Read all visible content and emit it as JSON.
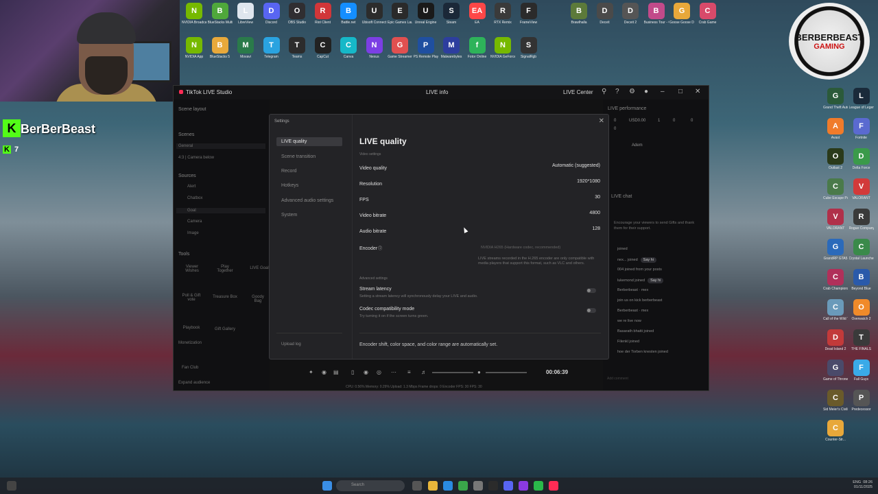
{
  "webcam": {
    "channel_name": "BerBerBeast",
    "kick_logo": "K",
    "kick_count_icon": "K",
    "viewer_count": "7"
  },
  "badge": {
    "line1": "BERBERBEAST",
    "line2": "GAMING"
  },
  "desktop_top_row1": [
    {
      "label": "NVIDIA Broadcast",
      "color": "#76b900",
      "glyph": "N"
    },
    {
      "label": "BlueStacks Multi-Insta...",
      "color": "#4fa83b",
      "glyph": "B"
    },
    {
      "label": "LibreView",
      "color": "#dfe6ee",
      "glyph": "L"
    },
    {
      "label": "Discord",
      "color": "#5865f2",
      "glyph": "D"
    },
    {
      "label": "OBS Studio",
      "color": "#302e31",
      "glyph": "O"
    },
    {
      "label": "Riot Client",
      "color": "#d13639",
      "glyph": "R"
    },
    {
      "label": "Battle.net",
      "color": "#148eff",
      "glyph": "B"
    },
    {
      "label": "Ubisoft Connect",
      "color": "#2c2c2c",
      "glyph": "U"
    },
    {
      "label": "Epic Games Launcher",
      "color": "#2a2a2a",
      "glyph": "E"
    },
    {
      "label": "Unreal Engine",
      "color": "#1a1a1a",
      "glyph": "U"
    },
    {
      "label": "Steam",
      "color": "#1b2838",
      "glyph": "S"
    },
    {
      "label": "EA",
      "color": "#ff4747",
      "glyph": "EA"
    },
    {
      "label": "RTX Remix",
      "color": "#3a3a3a",
      "glyph": "R"
    },
    {
      "label": "FrameView",
      "color": "#2b2b2b",
      "glyph": "F"
    }
  ],
  "desktop_top_row2": [
    {
      "label": "NVIDIA App",
      "color": "#76b900",
      "glyph": "N"
    },
    {
      "label": "BlueStacks 5",
      "color": "#e8a93b",
      "glyph": "B"
    },
    {
      "label": "Movavi",
      "color": "#2a7a4a",
      "glyph": "M"
    },
    {
      "label": "Telegram",
      "color": "#2aa3e0",
      "glyph": "T"
    },
    {
      "label": "Teams",
      "color": "#2c2c2c",
      "glyph": "T"
    },
    {
      "label": "CapCut",
      "color": "#222",
      "glyph": "C"
    },
    {
      "label": "Canva",
      "color": "#16b8c8",
      "glyph": "C"
    },
    {
      "label": "Nexus",
      "color": "#7b3fe4",
      "glyph": "N"
    },
    {
      "label": "Game Streamer",
      "color": "#e05050",
      "glyph": "G"
    },
    {
      "label": "PS Remote Play",
      "color": "#1f4fa0",
      "glyph": "P"
    },
    {
      "label": "Malwarebytes",
      "color": "#2d3e9e",
      "glyph": "M"
    },
    {
      "label": "Fotor Online",
      "color": "#2eb35a",
      "glyph": "f"
    },
    {
      "label": "NVIDIA GeForce",
      "color": "#76b900",
      "glyph": "N"
    },
    {
      "label": "SignalRgb",
      "color": "#333",
      "glyph": "S"
    }
  ],
  "desktop_top_right": [
    {
      "label": "Brawlhalla",
      "color": "#5c7a3a",
      "glyph": "B"
    },
    {
      "label": "Deceit",
      "color": "#4a4a4a",
      "glyph": "D"
    },
    {
      "label": "Deceit 2",
      "color": "#555",
      "glyph": "D"
    },
    {
      "label": "Business Tour - Onli...",
      "color": "#c24a8a",
      "glyph": "B"
    },
    {
      "label": "Goose Goose Duck",
      "color": "#e8a83a",
      "glyph": "G"
    },
    {
      "label": "Crab Game",
      "color": "#d84a6a",
      "glyph": "C"
    }
  ],
  "desktop_right_col": [
    {
      "label": "Grand Theft Auto V En...",
      "color": "#2b5a3a",
      "glyph": "G"
    },
    {
      "label": "League of Legends",
      "color": "#1a2a3a",
      "glyph": "L"
    },
    {
      "label": "Avast",
      "color": "#f07b2a",
      "glyph": "A"
    },
    {
      "label": "Fortnite",
      "color": "#5a6ad0",
      "glyph": "F"
    },
    {
      "label": "Outlast 2",
      "color": "#2a3a1a",
      "glyph": "O"
    },
    {
      "label": "Delta Force",
      "color": "#3a9a4a",
      "glyph": "D"
    },
    {
      "label": "Cube Escape Paradox",
      "color": "#4a7a4a",
      "glyph": "C"
    },
    {
      "label": "VALORANT",
      "color": "#d23a3a",
      "glyph": "V"
    },
    {
      "label": "VALORANT",
      "color": "#b0304a",
      "glyph": "V"
    },
    {
      "label": "Rogue Company",
      "color": "#3a3a3a",
      "glyph": "R"
    },
    {
      "label": "GrandRP GTA5",
      "color": "#2b6aba",
      "glyph": "G"
    },
    {
      "label": "Crystal Launcher",
      "color": "#3a8a4a",
      "glyph": "C"
    },
    {
      "label": "Crab Champions",
      "color": "#b0305a",
      "glyph": "C"
    },
    {
      "label": "Beyond Blue",
      "color": "#2a5aaa",
      "glyph": "B"
    },
    {
      "label": "Call of the Wild Th...",
      "color": "#6a9aba",
      "glyph": "C"
    },
    {
      "label": "Overwatch 2",
      "color": "#f08a2a",
      "glyph": "O"
    },
    {
      "label": "Dead Island 2",
      "color": "#c23a3a",
      "glyph": "D"
    },
    {
      "label": "THE FINALS",
      "color": "#3a3a3a",
      "glyph": "T"
    },
    {
      "label": "Game of Thrones...",
      "color": "#4a4a6a",
      "glyph": "G"
    },
    {
      "label": "Fall Guys",
      "color": "#3aaae8",
      "glyph": "F"
    },
    {
      "label": "Sid Meier's Civilization VI",
      "color": "#6a5a2a",
      "glyph": "C"
    },
    {
      "label": "Predecessor",
      "color": "#555",
      "glyph": "P"
    },
    {
      "label": "Counter-Str...",
      "color": "#e8a83a",
      "glyph": "C"
    }
  ],
  "studio": {
    "app_title": "TikTok LIVE Studio",
    "center_title": "LIVE info",
    "live_center": "LIVE Center",
    "left": {
      "scene_layout": "Scene layout",
      "scenes_header": "Scenes",
      "scenes": [
        "General",
        "4:3 | Camera below"
      ],
      "sources_header": "Sources",
      "sources": [
        "Alert",
        "Chatbox",
        "Goal",
        "Camera",
        "Image"
      ],
      "tools_header": "Tools",
      "tools": [
        "Viewer Wishes",
        "Play Together",
        "LIVE Goal",
        "Poll & Gift vote",
        "Treasure Box",
        "Goody Bag",
        "Playbook",
        "Gift Gallery"
      ],
      "monetization_header": "Monetization",
      "fan_club": "Fan Club",
      "expand_audience": "Expand audience"
    },
    "right": {
      "perf_header": "LIVE performance",
      "stats": [
        "0",
        "USD0.00",
        "1",
        "0",
        "0"
      ],
      "stat_row2": "0",
      "host_name": "Adem",
      "chat_header": "LIVE chat",
      "chat_prompt": "Encourage your viewers to send Gifts and thank them for their support.",
      "chat": [
        {
          "text": "joined",
          "sayhi": ""
        },
        {
          "text": "nex... joined",
          "sayhi": "Say hi"
        },
        {
          "text": "004 joined from your posts",
          "sayhi": ""
        },
        {
          "text": "lukemond joined",
          "sayhi": "Say hi"
        },
        {
          "text": "Berberbeast · mex",
          "sayhi": ""
        },
        {
          "text": "join us on kick berberbeast",
          "sayhi": ""
        },
        {
          "text": "Berberbeast · mex",
          "sayhi": ""
        },
        {
          "text": "we re live now",
          "sayhi": ""
        },
        {
          "text": "Basarath bhatti joined",
          "sayhi": ""
        },
        {
          "text": "Filenkl joined",
          "sayhi": ""
        },
        {
          "text": "hoe der Torben knesten joined",
          "sayhi": ""
        }
      ],
      "comment_placeholder": "Add comment"
    },
    "timer": "00:06:39",
    "status_line": "CPU: 0.56%    Memory: 0.29%    Upload: 1.3 Mbps    Frame drops: 0    Encoder FPS: 30    FPS: 30"
  },
  "settings": {
    "title": "Settings",
    "nav": [
      "LIVE quality",
      "Scene transition",
      "Record",
      "Hotkeys",
      "Advanced audio settings",
      "System"
    ],
    "upload_log": "Upload log",
    "heading": "LIVE quality",
    "video_settings_label": "Video settings",
    "rows": [
      {
        "label": "Video quality",
        "value": "Automatic (suggested)"
      },
      {
        "label": "Resolution",
        "value": "1920*1080"
      },
      {
        "label": "FPS",
        "value": "30"
      },
      {
        "label": "Video bitrate",
        "value": "4800"
      },
      {
        "label": "Audio bitrate",
        "value": "128"
      }
    ],
    "encoder_label": "Encoder",
    "encoder_value": "NVIDIA H265 (Hardware codec, recommended)",
    "encoder_note": "LIVE streams recorded in the H.265 encoder are only compatible with media players that support this format, such as VLC and others.",
    "advanced_label": "Advanced settings",
    "stream_latency": "Stream latency",
    "stream_latency_note": "Setting a stream latency will synchronously delay your LIVE and audio.",
    "codec_compat": "Codec compatibility mode",
    "codec_compat_note": "Try turning it on if the screen turns green.",
    "bottom_note": "Encoder shift, color space, and color range are automatically set."
  },
  "taskbar": {
    "search_placeholder": "Search",
    "time": "08:26",
    "date": "01/11/2025",
    "lang": "ENG"
  }
}
